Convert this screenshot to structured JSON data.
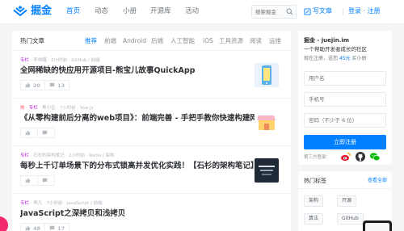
{
  "header": {
    "logo_text": "掘金",
    "nav": [
      "首页",
      "动态",
      "小册",
      "开源库",
      "活动"
    ],
    "search_placeholder": "搜索掘金",
    "write_label": "写文章",
    "login_label": "登录 · 注册"
  },
  "feed": {
    "title": "热门文章",
    "tabs": [
      "推荐",
      "前端",
      "Android",
      "后端",
      "人工智能",
      "iOS",
      "工具资源",
      "阅读",
      "运维"
    ],
    "articles": [
      {
        "tag": "专栏",
        "meta": " · 李帅醒 · 2小时前 · GitHub / 前端",
        "title": "全网稀缺的快应用开源项目-熊宝儿故事QuickApp",
        "likes": "20",
        "comments": "13"
      },
      {
        "tag_hot": "热",
        "tag": "专栏",
        "meta": " · 黑小伍 · 7小时前 · Vue.js",
        "title": "《从零构建前后分离的web项目》：前端完善 - 手把手教你快速构建网站布...",
        "likes": "",
        "comments": ""
      },
      {
        "tag": "专栏",
        "meta": " · 石杉的架构笔记 · 2小时前 · Redis / 架构",
        "title": "每秒上千订单场景下的分布式锁高并发优化实践！【石杉的架构笔记】",
        "likes": "",
        "comments": ""
      },
      {
        "tag": "专栏",
        "meta": " · 熊凡 · 7小时前 · JavaScript / 前端",
        "title": "JavaScript之深拷贝和浅拷贝",
        "likes": "48",
        "comments": "17"
      }
    ]
  },
  "sidebar": {
    "site": "掘金 - juejin.im",
    "slogan": "一个帮助开发者成长的社区",
    "promo_prefix": "现在注册，送您 ",
    "promo_amount": "45元",
    "promo_suffix": " 买小册",
    "username_placeholder": "用户名",
    "phone_placeholder": "手机号",
    "password_placeholder": "密码（不少于 6 位）",
    "register_label": "立即注册",
    "third_party_label": "第三方登录："
  },
  "tags_panel": {
    "title": "热门标签",
    "all_label": "查看全部",
    "tags": [
      "架构",
      "开源",
      "算法",
      "GitHub"
    ]
  },
  "colors": {
    "brand": "#007fff",
    "hot": "#f4485b",
    "column": "#b71ed7",
    "weibo": "#e6162d",
    "wechat": "#09bb07"
  }
}
